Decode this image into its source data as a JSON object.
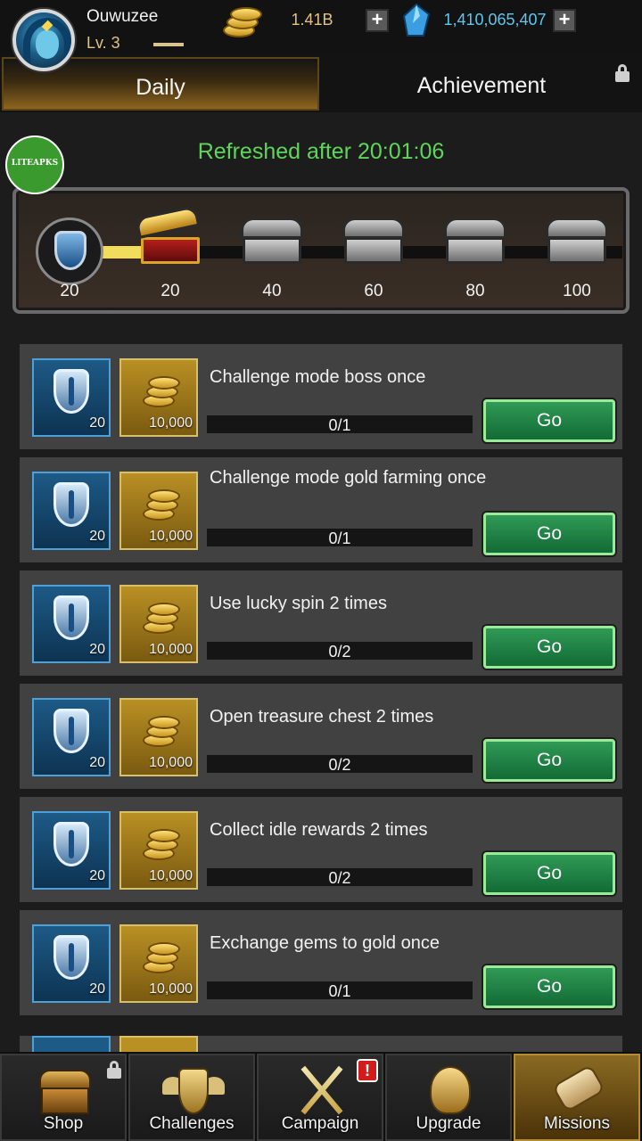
{
  "player": {
    "name": "Ouwuzee",
    "level": "Lv. 3"
  },
  "resources": {
    "gold": "1.41B",
    "gems": "1,410,065,407",
    "add_label": "+"
  },
  "tabs": {
    "daily": "Daily",
    "achievement": "Achievement"
  },
  "brand_badge": "LITEAPKS",
  "refresh_text": "Refreshed after 20:01:06",
  "milestones": [
    "20",
    "20",
    "40",
    "60",
    "80",
    "100"
  ],
  "milestone_progress": 0.2,
  "tasks": [
    {
      "title": "Challenge mode boss once",
      "shield_reward": "20",
      "gold_reward": "10,000",
      "progress": "0/1",
      "button": "Go"
    },
    {
      "title": "Challenge mode gold farming once",
      "shield_reward": "20",
      "gold_reward": "10,000",
      "progress": "0/1",
      "button": "Go"
    },
    {
      "title": "Use lucky spin 2 times",
      "shield_reward": "20",
      "gold_reward": "10,000",
      "progress": "0/2",
      "button": "Go"
    },
    {
      "title": "Open treasure chest 2 times",
      "shield_reward": "20",
      "gold_reward": "10,000",
      "progress": "0/2",
      "button": "Go"
    },
    {
      "title": "Collect idle rewards 2 times",
      "shield_reward": "20",
      "gold_reward": "10,000",
      "progress": "0/2",
      "button": "Go"
    },
    {
      "title": "Exchange gems to gold once",
      "shield_reward": "20",
      "gold_reward": "10,000",
      "progress": "0/1",
      "button": "Go"
    }
  ],
  "nav": [
    {
      "label": "Shop"
    },
    {
      "label": "Challenges"
    },
    {
      "label": "Campaign",
      "alert": "!"
    },
    {
      "label": "Upgrade"
    },
    {
      "label": "Missions"
    }
  ],
  "colors": {
    "accent_green": "#5ed65a",
    "gold_text": "#e2c383",
    "gem_text": "#5ec6f0",
    "button_green": "#1f8a48"
  }
}
